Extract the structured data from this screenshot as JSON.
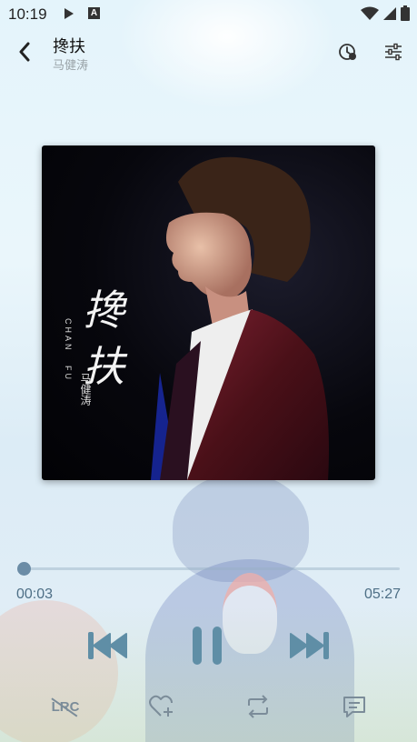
{
  "status_bar": {
    "time": "10:19",
    "icons": [
      "play-icon",
      "a-icon",
      "wifi-icon",
      "signal-icon",
      "battery-icon"
    ]
  },
  "header": {
    "title": "搀扶",
    "artist": "马健涛",
    "icons": [
      "back-icon",
      "timer-icon",
      "equalizer-icon"
    ]
  },
  "album": {
    "calligraphy": "搀扶",
    "pinyin_1": "CHAN",
    "pinyin_2": "FU",
    "artist_text": "马健涛"
  },
  "player": {
    "current_time": "00:03",
    "total_time": "05:27",
    "progress": 0.01,
    "state": "playing",
    "controls": [
      "previous-icon",
      "pause-icon",
      "next-icon"
    ]
  },
  "bottom_bar": {
    "lrc_label": "LRC",
    "icons": [
      "lyrics-off-icon",
      "favorite-add-icon",
      "repeat-icon",
      "comment-icon"
    ]
  },
  "colors": {
    "accent": "#6b8ca6",
    "control": "#5f8ea6",
    "time_text": "#4e6f86"
  }
}
